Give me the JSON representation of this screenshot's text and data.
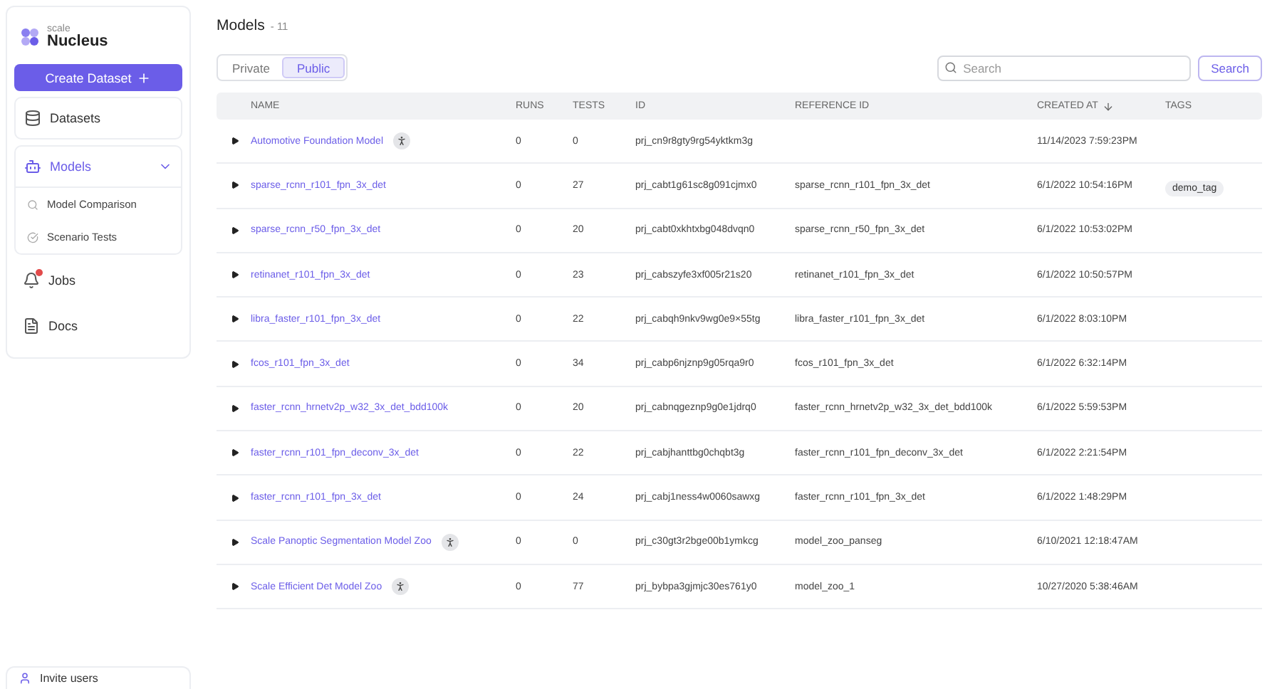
{
  "brand": {
    "small": "scale",
    "name": "Nucleus"
  },
  "create_button": "Create Dataset",
  "sidebar": {
    "items": [
      {
        "label": "Datasets",
        "kind": "card"
      },
      {
        "label": "Models",
        "kind": "group",
        "expanded": true,
        "children": [
          {
            "label": "Model Comparison"
          },
          {
            "label": "Scenario Tests"
          }
        ]
      },
      {
        "label": "Jobs",
        "kind": "plain",
        "notification": true
      },
      {
        "label": "Docs",
        "kind": "plain",
        "notification": false
      }
    ],
    "footer": "Invite users"
  },
  "page": {
    "title": "Models",
    "count": "- 11"
  },
  "tabs": [
    {
      "label": "Private",
      "selected": false
    },
    {
      "label": "Public",
      "selected": true
    }
  ],
  "search": {
    "placeholder": "Search",
    "button": "Search"
  },
  "table": {
    "columns": [
      {
        "label": "NAME",
        "sorted": false
      },
      {
        "label": "RUNS",
        "sorted": false
      },
      {
        "label": "TESTS",
        "sorted": false
      },
      {
        "label": "ID",
        "sorted": false
      },
      {
        "label": "REFERENCE ID",
        "sorted": false
      },
      {
        "label": "CREATED AT",
        "sorted": true
      },
      {
        "label": "TAGS",
        "sorted": false
      }
    ],
    "rows": [
      {
        "name": "Automotive Foundation Model",
        "badge": true,
        "runs": "0",
        "tests": "0",
        "id": "prj_cn9r8gty9rg54yktkm3g",
        "ref": "",
        "created": "11/14/2023 7:59:23PM",
        "tags": []
      },
      {
        "name": "sparse_rcnn_r101_fpn_3x_det",
        "badge": false,
        "runs": "0",
        "tests": "27",
        "id": "prj_cabt1g61sc8g091cjmx0",
        "ref": "sparse_rcnn_r101_fpn_3x_det",
        "created": "6/1/2022 10:54:16PM",
        "tags": [
          "demo_tag"
        ]
      },
      {
        "name": "sparse_rcnn_r50_fpn_3x_det",
        "badge": false,
        "runs": "0",
        "tests": "20",
        "id": "prj_cabt0xkhtxbg048dvqn0",
        "ref": "sparse_rcnn_r50_fpn_3x_det",
        "created": "6/1/2022 10:53:02PM",
        "tags": []
      },
      {
        "name": "retinanet_r101_fpn_3x_det",
        "badge": false,
        "runs": "0",
        "tests": "23",
        "id": "prj_cabszyfe3xf005r21s20",
        "ref": "retinanet_r101_fpn_3x_det",
        "created": "6/1/2022 10:50:57PM",
        "tags": []
      },
      {
        "name": "libra_faster_r101_fpn_3x_det",
        "badge": false,
        "runs": "0",
        "tests": "22",
        "id": "prj_cabqh9nkv9wg0e9×55tg",
        "ref": "libra_faster_r101_fpn_3x_det",
        "created": "6/1/2022 8:03:10PM",
        "tags": []
      },
      {
        "name": "fcos_r101_fpn_3x_det",
        "badge": false,
        "runs": "0",
        "tests": "34",
        "id": "prj_cabp6njznp9g05rqa9r0",
        "ref": "fcos_r101_fpn_3x_det",
        "created": "6/1/2022 6:32:14PM",
        "tags": []
      },
      {
        "name": "faster_rcnn_hrnetv2p_w32_3x_det_bdd100k",
        "badge": false,
        "runs": "0",
        "tests": "20",
        "id": "prj_cabnqgeznp9g0e1jdrq0",
        "ref": "faster_rcnn_hrnetv2p_w32_3x_det_bdd100k",
        "created": "6/1/2022 5:59:53PM",
        "tags": []
      },
      {
        "name": "faster_rcnn_r101_fpn_deconv_3x_det",
        "badge": false,
        "runs": "0",
        "tests": "22",
        "id": "prj_cabjhanttbg0chqbt3g",
        "ref": "faster_rcnn_r101_fpn_deconv_3x_det",
        "created": "6/1/2022 2:21:54PM",
        "tags": []
      },
      {
        "name": "faster_rcnn_r101_fpn_3x_det",
        "badge": false,
        "runs": "0",
        "tests": "24",
        "id": "prj_cabj1ness4w0060sawxg",
        "ref": "faster_rcnn_r101_fpn_3x_det",
        "created": "6/1/2022 1:48:29PM",
        "tags": []
      },
      {
        "name": "Scale Panoptic Segmentation Model Zoo",
        "badge": true,
        "runs": "0",
        "tests": "0",
        "id": "prj_c30gt3r2bge00b1ymkcg",
        "ref": "model_zoo_panseg",
        "created": "6/10/2021 12:18:47AM",
        "tags": []
      },
      {
        "name": "Scale Efficient Det Model Zoo",
        "badge": true,
        "runs": "0",
        "tests": "77",
        "id": "prj_bybpa3gjmjc30es761y0",
        "ref": "model_zoo_1",
        "created": "10/27/2020 5:38:46AM",
        "tags": []
      }
    ]
  }
}
